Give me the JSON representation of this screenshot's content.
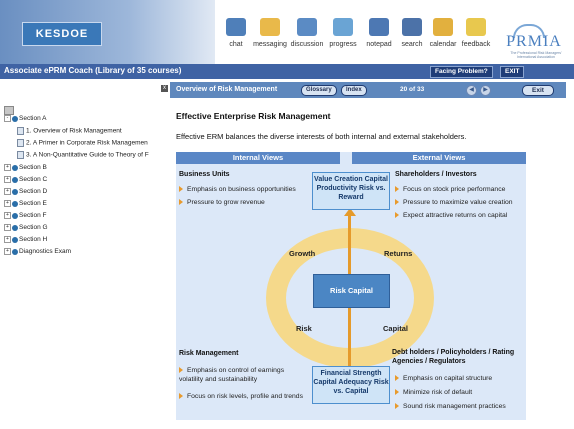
{
  "header": {
    "logo_text": "KESDOE",
    "tools": [
      {
        "label": "chat",
        "icon": "chat-icon",
        "color": "#4f7fb9"
      },
      {
        "label": "messaging",
        "icon": "folder-icon",
        "color": "#e9b94a"
      },
      {
        "label": "discussion",
        "icon": "people-icon",
        "color": "#5b8bc4"
      },
      {
        "label": "progress",
        "icon": "progress-icon",
        "color": "#6aa4d4"
      },
      {
        "label": "notepad",
        "icon": "notepad-icon",
        "color": "#4d78b3"
      },
      {
        "label": "search",
        "icon": "search-icon",
        "color": "#4c72a8"
      },
      {
        "label": "calendar",
        "icon": "calendar-icon",
        "color": "#e2b03e"
      },
      {
        "label": "feedback",
        "icon": "feedback-icon",
        "color": "#e8c84e"
      }
    ],
    "partner_logo": "PRMIA",
    "partner_sub": "The Professional Risk Managers' International Association"
  },
  "title_strip": {
    "course_title": "Associate ePRM Coach (Library of 35 courses)",
    "facing_problem": "Facing Problem?",
    "exit": "EXIT"
  },
  "nav": {
    "items": [
      {
        "label": "Section A",
        "level": 0
      },
      {
        "label": "1. Overview of Risk Management",
        "level": 1
      },
      {
        "label": "2. A Primer in Corporate Risk Managemen",
        "level": 1
      },
      {
        "label": "3. A Non-Quantitative Guide to Theory of F",
        "level": 1
      },
      {
        "label": "Section B",
        "level": 0
      },
      {
        "label": "Section C",
        "level": 0
      },
      {
        "label": "Section D",
        "level": 0
      },
      {
        "label": "Section E",
        "level": 0
      },
      {
        "label": "Section F",
        "level": 0
      },
      {
        "label": "Section G",
        "level": 0
      },
      {
        "label": "Section H",
        "level": 0
      },
      {
        "label": "Diagnostics Exam",
        "level": 0
      }
    ]
  },
  "lesson_bar": {
    "title": "Overview of Risk Management",
    "glossary": "Glossary",
    "index": "Index",
    "page": "20 of 33",
    "exit": "Exit",
    "close": "x"
  },
  "content": {
    "heading": "Effective Enterprise Risk Management",
    "intro": "Effective ERM balances the diverse interests of both internal and external stakeholders."
  },
  "diagram": {
    "internal_header": "Internal Views",
    "external_header": "External Views",
    "business_units": {
      "title": "Business Units",
      "bullets": [
        "Emphasis on business opportunities",
        "Pressure to grow revenue"
      ]
    },
    "shareholders": {
      "title": "Shareholders / Investors",
      "bullets": [
        "Focus on stock price performance",
        "Pressure to maximize value creation",
        "Expect attractive returns on capital"
      ]
    },
    "risk_management": {
      "title": "Risk Management",
      "bullets": [
        "Emphasis on control of earnings volatility and sustainability",
        "Focus on risk levels, profile and trends"
      ]
    },
    "debt_holders": {
      "title": "Debt holders / Policyholders / Rating Agencies / Regulators",
      "bullets": [
        "Emphasis on capital structure",
        "Minimize risk of default",
        "Sound risk management practices"
      ]
    },
    "value_creation": "Value Creation Capital Productivity Risk vs. Reward",
    "financial_strength": "Financial Strength Capital Adequacy Risk vs. Capital",
    "center": "Risk Capital",
    "ring_labels": {
      "growth": "Growth",
      "returns": "Returns",
      "risk": "Risk",
      "capital": "Capital"
    }
  }
}
